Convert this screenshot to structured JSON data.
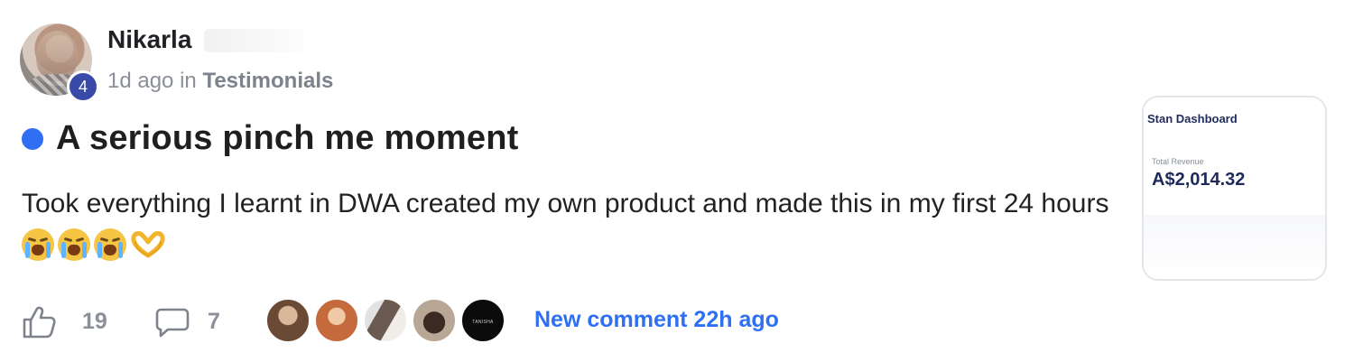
{
  "post": {
    "author": {
      "name": "Nikarla",
      "level": "4"
    },
    "meta": {
      "time": "1d ago",
      "in_label": "in",
      "category": "Testimonials"
    },
    "title": "A serious pinch me moment",
    "body_text": "Took everything I learnt in DWA created my own product and made this in my first 24 hours",
    "emoji": [
      "loudly-crying-face",
      "loudly-crying-face",
      "loudly-crying-face",
      "heart-hands"
    ],
    "attachment": {
      "title": "Stan Dashboard",
      "label": "Total Revenue",
      "value": "A$2,014.32"
    },
    "footer": {
      "like_count": "19",
      "comment_count": "7",
      "commenter_logo_text": "TANISHA BANERJI",
      "new_comment_label": "New comment 22h ago"
    },
    "colors": {
      "accent": "#2e6ff3",
      "level_badge": "#3a4aa8",
      "muted_text": "#8a8f98"
    }
  }
}
